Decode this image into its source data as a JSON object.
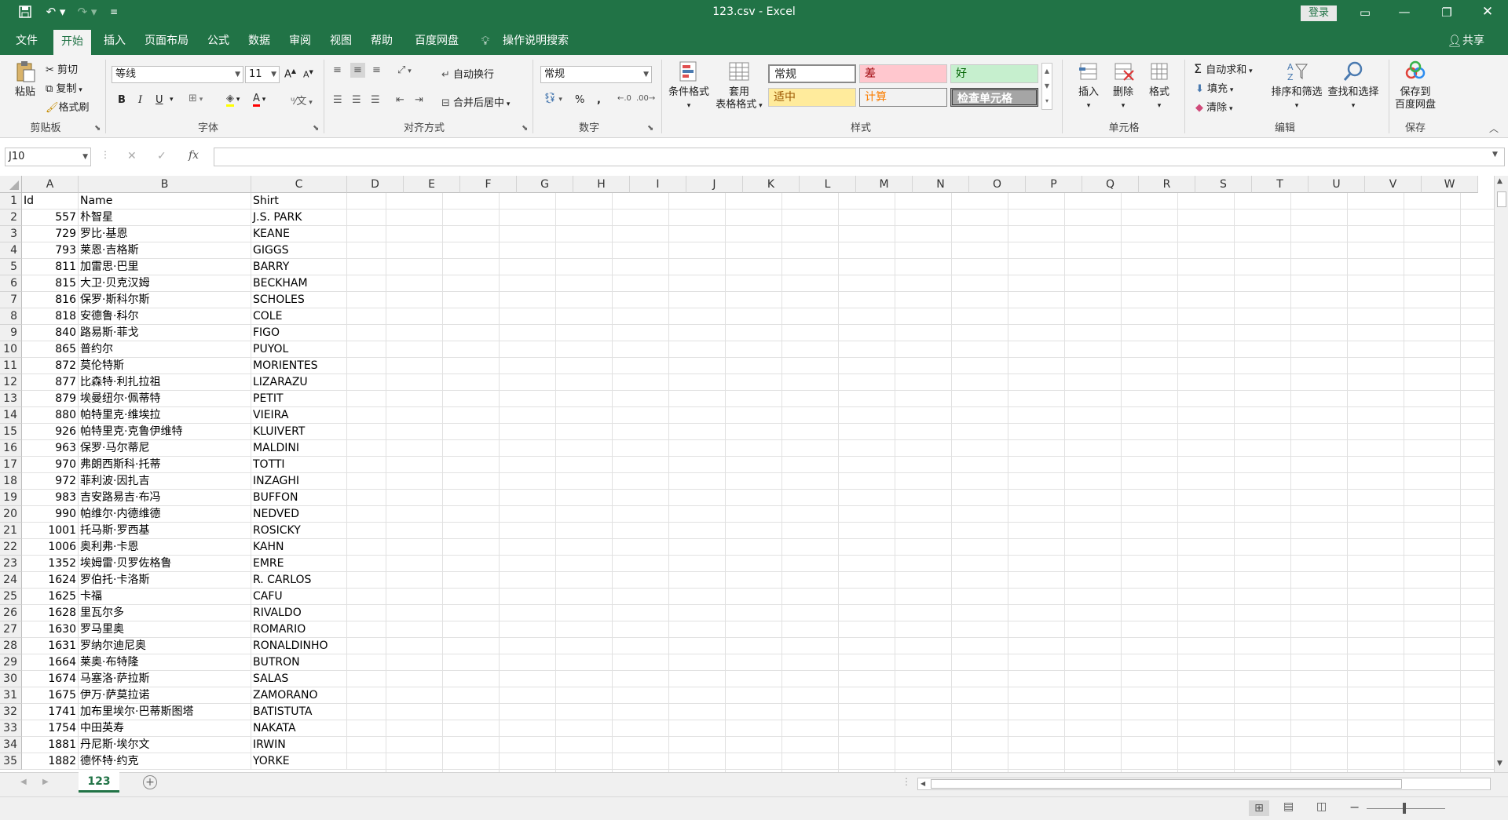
{
  "title": "123.csv  -  Excel",
  "login_label": "登录",
  "tabs": [
    "文件",
    "开始",
    "插入",
    "页面布局",
    "公式",
    "数据",
    "审阅",
    "视图",
    "帮助",
    "百度网盘"
  ],
  "search_label": "操作说明搜索",
  "share_label": "共享",
  "ribbon": {
    "clipboard": {
      "paste": "粘贴",
      "cut": "剪切",
      "copy": "复制",
      "format_painter": "格式刷",
      "label": "剪贴板"
    },
    "font": {
      "name": "等线",
      "size": "11",
      "label": "字体",
      "bold": "B",
      "italic": "I",
      "underline": "U"
    },
    "align": {
      "wrap": "自动换行",
      "merge": "合并后居中",
      "label": "对齐方式"
    },
    "number": {
      "format": "常规",
      "percent": "%",
      "comma": ",",
      "label": "数字"
    },
    "styles": {
      "conditional": "条件格式",
      "table_line1": "套用",
      "table_line2": "表格格式",
      "normal": "常规",
      "bad": "差",
      "good": "好",
      "neutral": "适中",
      "calc": "计算",
      "check": "检查单元格",
      "label": "样式"
    },
    "cells": {
      "insert": "插入",
      "delete": "删除",
      "format": "格式",
      "label": "单元格"
    },
    "editing": {
      "autosum": "自动求和",
      "fill": "填充",
      "clear": "清除",
      "sort": "排序和筛选",
      "find": "查找和选择",
      "label": "编辑"
    },
    "save": {
      "line1": "保存到",
      "line2": "百度网盘",
      "label": "保存"
    },
    "colors": {
      "bad_bg": "#ffc7ce",
      "bad_fg": "#9c0006",
      "good_bg": "#c6efce",
      "good_fg": "#006100",
      "neutral_bg": "#ffeb9c",
      "neutral_fg": "#9c5700",
      "calc_bg": "#f2f2f2",
      "calc_fg": "#fa7d00",
      "check_bg": "#a5a5a5"
    }
  },
  "formula_bar": {
    "name_box": "J10",
    "fx": "fx",
    "value": ""
  },
  "columns": [
    "A",
    "B",
    "C",
    "D",
    "E",
    "F",
    "G",
    "H",
    "I",
    "J",
    "K",
    "L",
    "M",
    "N",
    "O",
    "P",
    "Q",
    "R",
    "S",
    "T",
    "U",
    "V",
    "W"
  ],
  "header_row": {
    "row": "1",
    "a": "Id",
    "b": "Name",
    "c": "Shirt"
  },
  "rows": [
    {
      "row": "2",
      "id": "557",
      "name": "朴智星",
      "shirt": "J.S. PARK"
    },
    {
      "row": "3",
      "id": "729",
      "name": "罗比·基恩",
      "shirt": "KEANE"
    },
    {
      "row": "4",
      "id": "793",
      "name": "莱恩·吉格斯",
      "shirt": "GIGGS"
    },
    {
      "row": "5",
      "id": "811",
      "name": "加雷思·巴里",
      "shirt": "BARRY"
    },
    {
      "row": "6",
      "id": "815",
      "name": "大卫·贝克汉姆",
      "shirt": "BECKHAM"
    },
    {
      "row": "7",
      "id": "816",
      "name": "保罗·斯科尔斯",
      "shirt": "SCHOLES"
    },
    {
      "row": "8",
      "id": "818",
      "name": "安德鲁·科尔",
      "shirt": "COLE"
    },
    {
      "row": "9",
      "id": "840",
      "name": "路易斯·菲戈",
      "shirt": "FIGO"
    },
    {
      "row": "10",
      "id": "865",
      "name": "普约尔",
      "shirt": "PUYOL"
    },
    {
      "row": "11",
      "id": "872",
      "name": "莫伦特斯",
      "shirt": "MORIENTES"
    },
    {
      "row": "12",
      "id": "877",
      "name": "比森特·利扎拉祖",
      "shirt": "LIZARAZU"
    },
    {
      "row": "13",
      "id": "879",
      "name": "埃曼纽尔·佩蒂特",
      "shirt": "PETIT"
    },
    {
      "row": "14",
      "id": "880",
      "name": "帕特里克·维埃拉",
      "shirt": "VIEIRA"
    },
    {
      "row": "15",
      "id": "926",
      "name": "帕特里克·克鲁伊维特",
      "shirt": "KLUIVERT"
    },
    {
      "row": "16",
      "id": "963",
      "name": "保罗·马尔蒂尼",
      "shirt": "MALDINI"
    },
    {
      "row": "17",
      "id": "970",
      "name": "弗朗西斯科·托蒂",
      "shirt": "TOTTI"
    },
    {
      "row": "18",
      "id": "972",
      "name": "菲利波·因扎吉",
      "shirt": "INZAGHI"
    },
    {
      "row": "19",
      "id": "983",
      "name": "吉安路易吉·布冯",
      "shirt": "BUFFON"
    },
    {
      "row": "20",
      "id": "990",
      "name": "帕维尔·内德维德",
      "shirt": "NEDVED"
    },
    {
      "row": "21",
      "id": "1001",
      "name": "托马斯·罗西基",
      "shirt": "ROSICKY"
    },
    {
      "row": "22",
      "id": "1006",
      "name": "奥利弗·卡恩",
      "shirt": "KAHN"
    },
    {
      "row": "23",
      "id": "1352",
      "name": "埃姆雷·贝罗佐格鲁",
      "shirt": "EMRE"
    },
    {
      "row": "24",
      "id": "1624",
      "name": "罗伯托·卡洛斯",
      "shirt": "R. CARLOS"
    },
    {
      "row": "25",
      "id": "1625",
      "name": "卡福",
      "shirt": "CAFU"
    },
    {
      "row": "26",
      "id": "1628",
      "name": "里瓦尔多",
      "shirt": "RIVALDO"
    },
    {
      "row": "27",
      "id": "1630",
      "name": "罗马里奥",
      "shirt": "ROMARIO"
    },
    {
      "row": "28",
      "id": "1631",
      "name": "罗纳尔迪尼奥",
      "shirt": "RONALDINHO"
    },
    {
      "row": "29",
      "id": "1664",
      "name": "莱奥·布特隆",
      "shirt": "BUTRON"
    },
    {
      "row": "30",
      "id": "1674",
      "name": "马塞洛·萨拉斯",
      "shirt": "SALAS"
    },
    {
      "row": "31",
      "id": "1675",
      "name": "伊万·萨莫拉诺",
      "shirt": "ZAMORANO"
    },
    {
      "row": "32",
      "id": "1741",
      "name": "加布里埃尔·巴蒂斯图塔",
      "shirt": "BATISTUTA"
    },
    {
      "row": "33",
      "id": "1754",
      "name": "中田英寿",
      "shirt": "NAKATA"
    },
    {
      "row": "34",
      "id": "1881",
      "name": "丹尼斯·埃尔文",
      "shirt": "IRWIN"
    },
    {
      "row": "35",
      "id": "1882",
      "name": "德怀特·约克",
      "shirt": "YORKE"
    }
  ],
  "sheet_tab": "123",
  "accent": "#217346"
}
